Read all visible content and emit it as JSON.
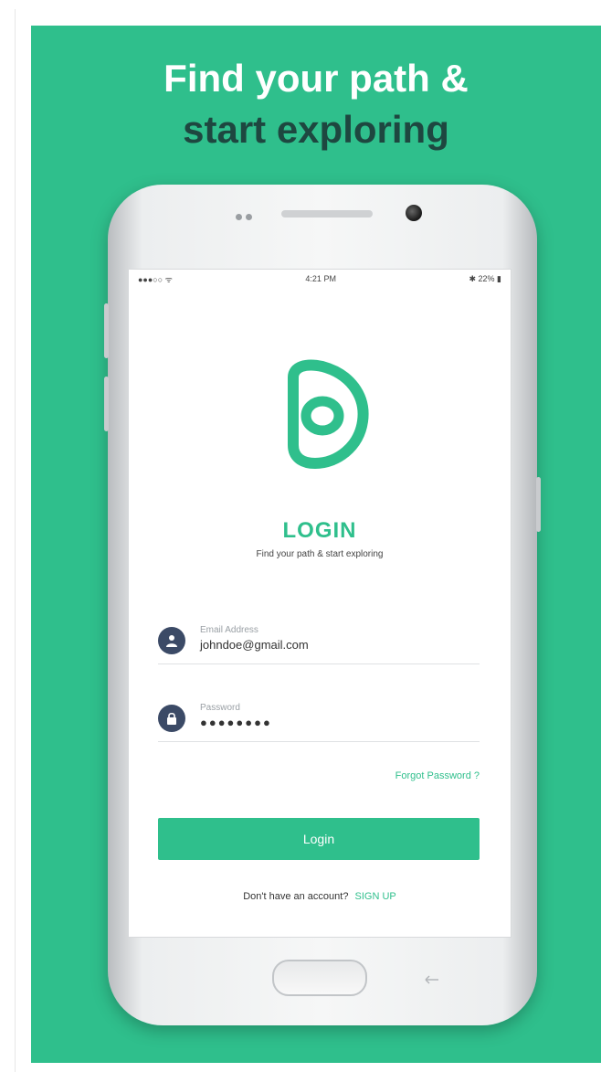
{
  "headline": {
    "line1": "Find your path &",
    "line2": "start exploring"
  },
  "status_bar": {
    "left": "●●●○○ ᯤ",
    "time": "4:21 PM",
    "right": "✱ 22% ▮"
  },
  "login": {
    "title": "LOGIN",
    "subtitle": "Find your path & start exploring",
    "email": {
      "label": "Email Address",
      "value": "johndoe@gmail.com"
    },
    "password": {
      "label": "Password",
      "value": "●●●●●●●●"
    },
    "forgot": "Forgot Password ?",
    "button": "Login",
    "signup_prompt": "Don't have an account?",
    "signup_link": "SIGN UP"
  },
  "colors": {
    "brand": "#2fbf8c",
    "dark_text": "#1e4740",
    "icon_bg": "#3b4a66"
  },
  "icons": {
    "logo": "path-logo-icon",
    "email": "user-icon",
    "password": "lock-icon"
  }
}
